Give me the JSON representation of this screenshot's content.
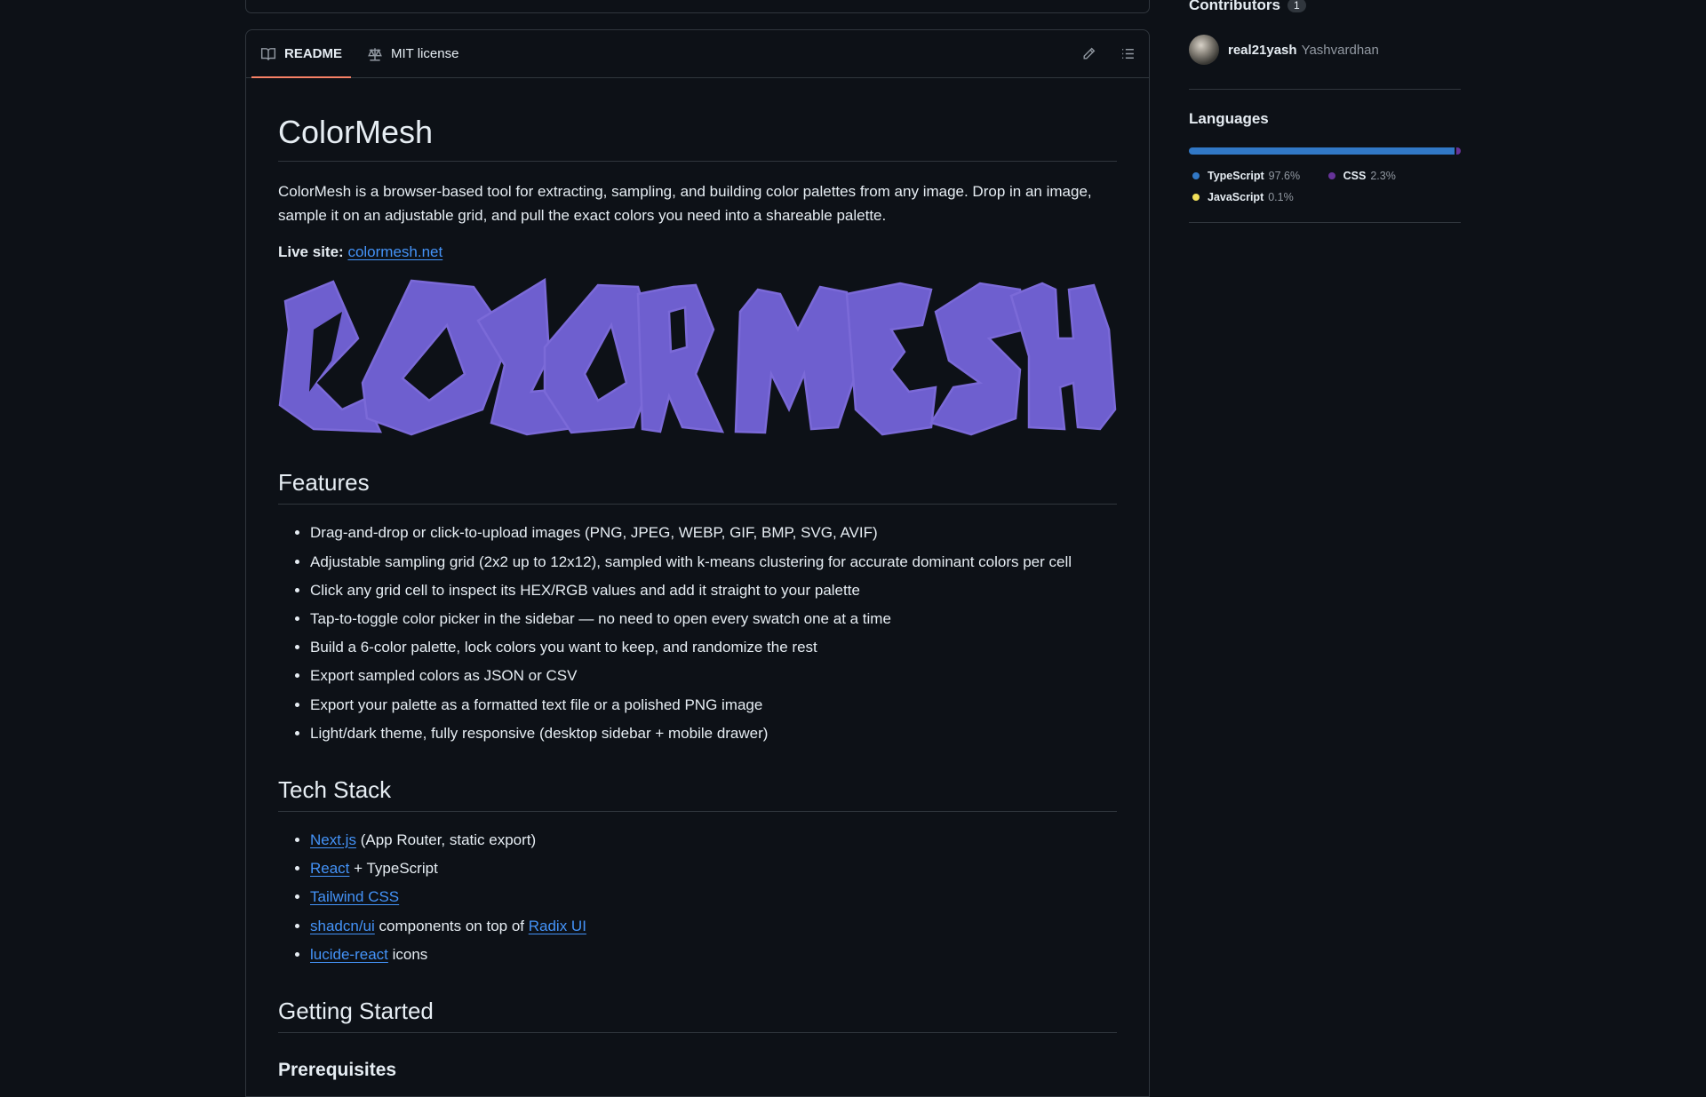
{
  "readme_tabs": [
    {
      "label": "README",
      "active": true
    },
    {
      "label": "MIT license",
      "active": false
    }
  ],
  "readme": {
    "title": "ColorMesh",
    "intro": "ColorMesh is a browser-based tool for extracting, sampling, and building color palettes from any image. Drop in an image, sample it on an adjustable grid, and pull the exact colors you need into a shareable palette.",
    "live_label": "Live site:",
    "live_link": "colormesh.net",
    "banner_text": "COLOR MESH",
    "features_heading": "Features",
    "features": [
      "Drag-and-drop or click-to-upload images (PNG, JPEG, WEBP, GIF, BMP, SVG, AVIF)",
      "Adjustable sampling grid (2x2 up to 12x12), sampled with k-means clustering for accurate dominant colors per cell",
      "Click any grid cell to inspect its HEX/RGB values and add it straight to your palette",
      "Tap-to-toggle color picker in the sidebar — no need to open every swatch one at a time",
      "Build a 6-color palette, lock colors you want to keep, and randomize the rest",
      "Export sampled colors as JSON or CSV",
      "Export your palette as a formatted text file or a polished PNG image",
      "Light/dark theme, fully responsive (desktop sidebar + mobile drawer)"
    ],
    "tech_heading": "Tech Stack",
    "tech": {
      "nextjs_link": "Next.js",
      "nextjs_rest": " (App Router, static export)",
      "react_link": "React",
      "react_rest": " + TypeScript",
      "tailwind_link": "Tailwind CSS",
      "shadcn_link": "shadcn/ui",
      "shadcn_mid": " components on top of ",
      "radix_link": "Radix UI",
      "lucide_link": "lucide-react",
      "lucide_rest": " icons"
    },
    "getting_started_heading": "Getting Started",
    "prereq_heading": "Prerequisites"
  },
  "sidebar": {
    "contributors_label": "Contributors",
    "contributors_count": "1",
    "contributor_login": "real21yash",
    "contributor_name": "Yashvardhan",
    "languages_label": "Languages",
    "languages": [
      {
        "name": "TypeScript",
        "percent": "97.6%",
        "value": 97.6,
        "color": "#3178c6"
      },
      {
        "name": "CSS",
        "percent": "2.3%",
        "value": 2.3,
        "color": "#663399"
      },
      {
        "name": "JavaScript",
        "percent": "0.1%",
        "value": 0.1,
        "color": "#f1e05a"
      }
    ]
  },
  "colors": {
    "background": "#0d1117",
    "border": "#30363d",
    "link": "#4493f8",
    "banner_purple": "#6e5fcf",
    "tab_underline": "#f78166"
  }
}
